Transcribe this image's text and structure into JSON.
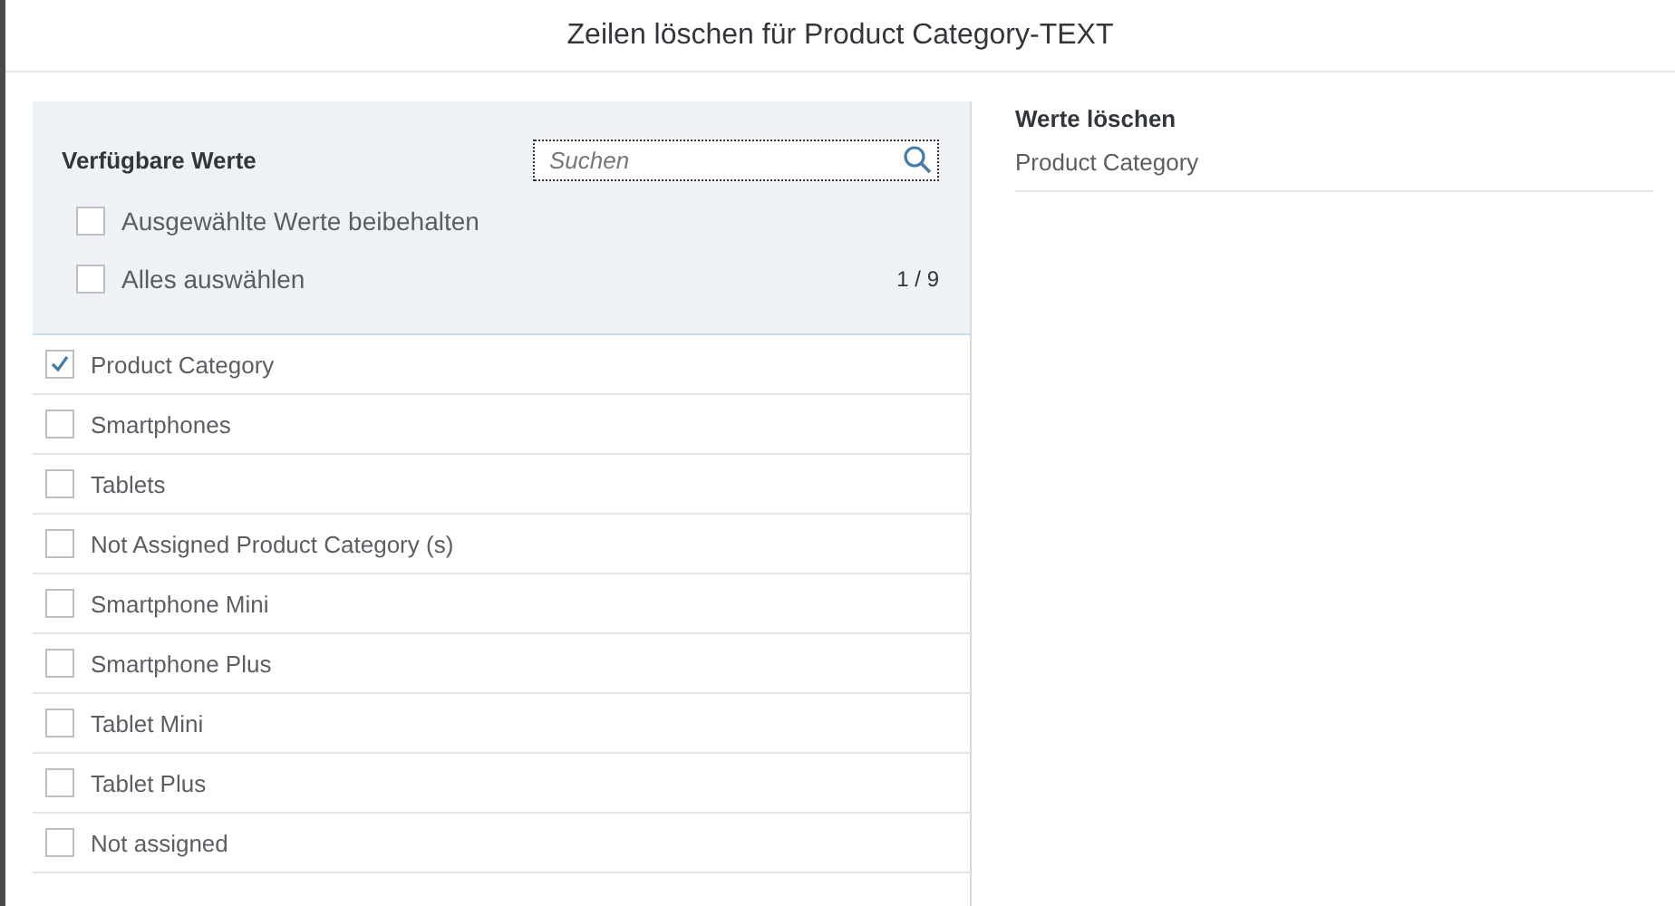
{
  "dialog": {
    "title": "Zeilen löschen für Product Category-TEXT"
  },
  "available": {
    "title": "Verfügbare Werte",
    "search": {
      "placeholder": "Suchen"
    },
    "options": [
      {
        "label": "Ausgewählte Werte beibehalten",
        "checked": false
      },
      {
        "label": "Alles auswählen",
        "checked": false
      }
    ],
    "count": "1 / 9",
    "items": [
      {
        "label": "Product Category",
        "checked": true
      },
      {
        "label": "Smartphones",
        "checked": false
      },
      {
        "label": "Tablets",
        "checked": false
      },
      {
        "label": "Not Assigned Product Category (s)",
        "checked": false
      },
      {
        "label": "Smartphone Mini",
        "checked": false
      },
      {
        "label": "Smartphone Plus",
        "checked": false
      },
      {
        "label": "Tablet Mini",
        "checked": false
      },
      {
        "label": "Tablet Plus",
        "checked": false
      },
      {
        "label": "Not assigned",
        "checked": false
      }
    ]
  },
  "delete": {
    "title": "Werte löschen",
    "items": [
      "Product Category"
    ]
  }
}
